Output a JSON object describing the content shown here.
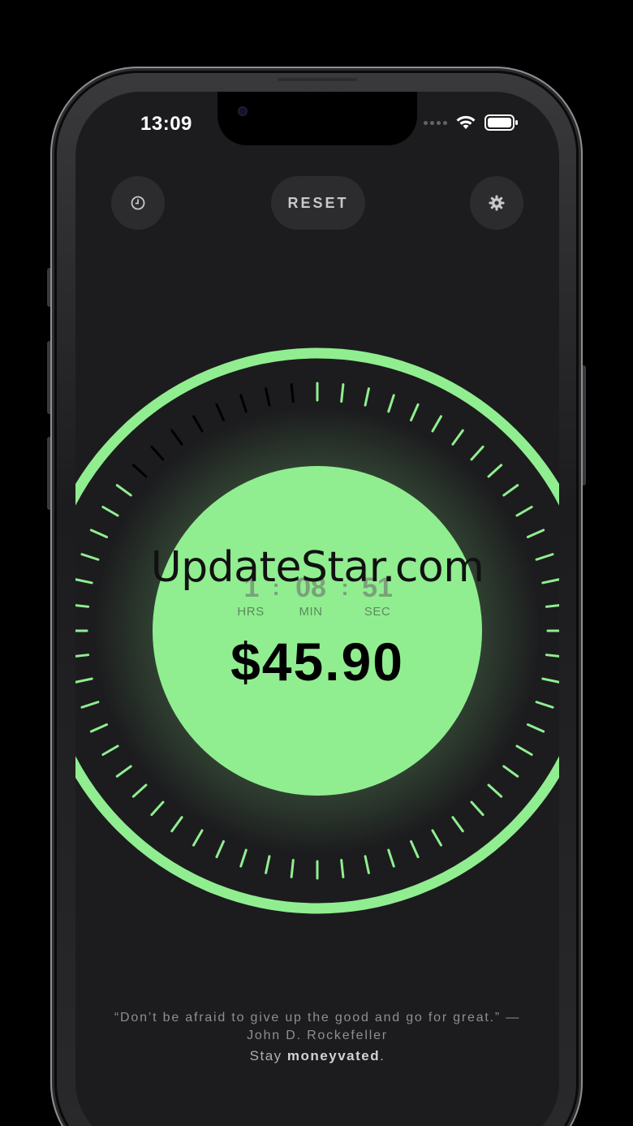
{
  "status_bar": {
    "time": "13:09",
    "icons": [
      "signal-dots-icon",
      "wifi-icon",
      "battery-icon"
    ]
  },
  "toolbar": {
    "history_icon": "clock-icon",
    "reset_label": "RESET",
    "settings_icon": "gear-icon"
  },
  "timer": {
    "hours": "1",
    "minutes": "08",
    "seconds": "51",
    "sep": ":",
    "hours_label": "HRS",
    "minutes_label": "MIN",
    "seconds_label": "SEC"
  },
  "earnings": {
    "amount": "$45.90"
  },
  "dial": {
    "tick_count": 60,
    "progress_fraction": 0.86,
    "accent_color": "#90ee90",
    "inactive_tick_color": "#000000"
  },
  "footer": {
    "quote": "“Don’t be afraid to give up the good and go for great.” — John D. Rockefeller",
    "tagline_prefix": "Stay ",
    "tagline_bold": "moneyvated",
    "tagline_suffix": "."
  },
  "watermark": "UpdateStar.com"
}
